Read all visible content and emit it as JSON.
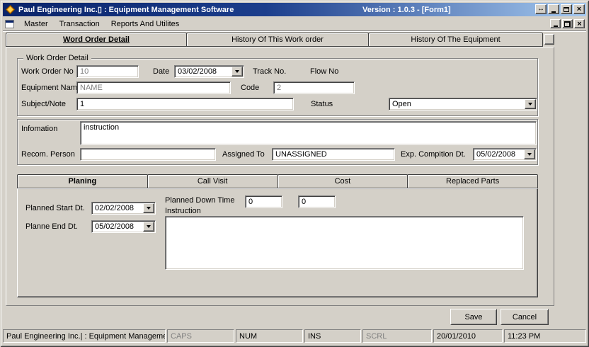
{
  "window": {
    "title": "Paul Engineering Inc.▯ : Equipment Management Software",
    "version": "Version : 1.0.3 - [Form1]",
    "resize_glyph": "↔",
    "close_glyph": "×"
  },
  "menu": {
    "items": [
      "Master",
      "Transaction",
      "Reports And Utilites"
    ]
  },
  "main_tabs": [
    "Word Order Detail",
    "History Of This Work order",
    "History Of The Equipment"
  ],
  "work_order": {
    "group_title": "Work Order Detail",
    "work_order_no_label": "Work Order No",
    "work_order_no_value": "10",
    "date_label": "Date",
    "date_value": "03/02/2008",
    "track_no_label": "Track No.",
    "flow_no_label": "Flow No",
    "equipment_name_label": "Equipment Name",
    "equipment_name_value": "NAME",
    "code_label": "Code",
    "code_value": "2",
    "subject_label": "Subject/Note",
    "subject_value": "1",
    "status_label": "Status",
    "status_value": "Open"
  },
  "details": {
    "information_label": "Infomation",
    "information_value": "instruction",
    "recom_person_label": "Recom. Person",
    "recom_person_value": "",
    "assigned_to_label": "Assigned To",
    "assigned_to_value": "UNASSIGNED",
    "exp_completion_label": "Exp. Compition Dt.",
    "exp_completion_value": "05/02/2008"
  },
  "sub_tabs": [
    "Planing",
    "Call Visit",
    "Cost",
    "Replaced Parts"
  ],
  "planning": {
    "planned_start_label": "Planned Start Dt.",
    "planned_start_value": "02/02/2008",
    "planned_down_time_label": "Planned Down Time",
    "down_time_value_1": "0",
    "down_time_value_2": "0",
    "planned_end_label": "Planne End Dt.",
    "planned_end_value": "05/02/2008",
    "instruction_label": "Instruction",
    "instruction_value": ""
  },
  "actions": {
    "save": "Save",
    "cancel": "Cancel"
  },
  "status_bar": {
    "app_text": "Paul Engineering Inc.| : Equipment Managemen",
    "caps": "CAPS",
    "num": "NUM",
    "ins": "INS",
    "scrl": "SCRL",
    "date": "20/01/2010",
    "time": "11:23 PM"
  },
  "colors": {
    "titlebar_start": "#0A246A",
    "titlebar_end": "#A6CAF0",
    "window_face": "#D4D0C8"
  }
}
